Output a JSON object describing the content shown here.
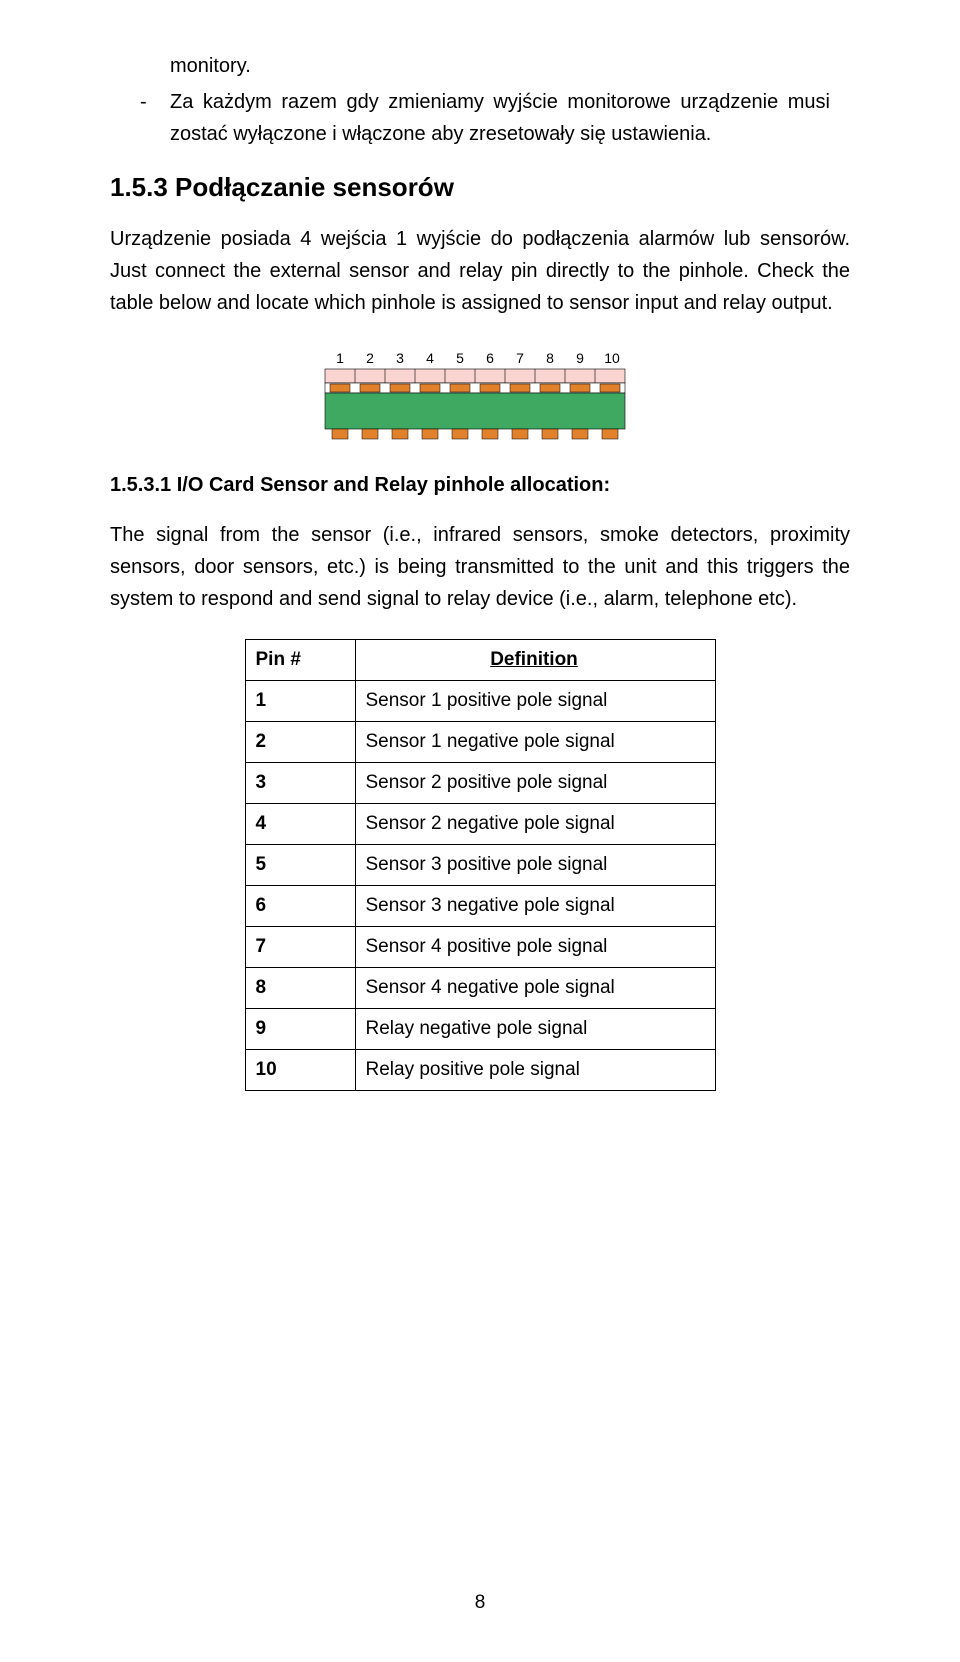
{
  "bullet1": "monitory.",
  "dash_text": "Za każdym razem gdy zmieniamy wyjście monitorowe urządzenie musi zostać wyłączone i włączone aby zresetowały się ustawienia.",
  "h2": "1.5.3  Podłączanie sensorów",
  "p1": "Urządzenie posiada 4 wejścia 1 wyjście do podłączenia alarmów lub sensorów. Just connect the external sensor and relay pin directly to the pinhole. Check the table below and locate which pinhole is assigned to sensor input and relay output.",
  "connector_labels": [
    "1",
    "2",
    "3",
    "4",
    "5",
    "6",
    "7",
    "8",
    "9",
    "10"
  ],
  "h3": "1.5.3.1 I/O Card Sensor and Relay pinhole allocation:",
  "p2": "The signal from the sensor (i.e., infrared sensors, smoke detectors, proximity sensors, door sensors, etc.) is being transmitted to the unit and this triggers the system to respond and send signal to relay device (i.e., alarm, telephone etc).",
  "table": {
    "head_pin": "Pin #",
    "head_def": "Definition",
    "rows": [
      {
        "pin": "1",
        "def": "Sensor 1 positive pole signal"
      },
      {
        "pin": "2",
        "def": "Sensor 1 negative pole signal"
      },
      {
        "pin": "3",
        "def": "Sensor 2 positive pole signal"
      },
      {
        "pin": "4",
        "def": "Sensor 2 negative pole signal"
      },
      {
        "pin": "5",
        "def": "Sensor 3 positive pole signal"
      },
      {
        "pin": "6",
        "def": "Sensor 3 negative pole signal"
      },
      {
        "pin": "7",
        "def": "Sensor 4 positive pole signal"
      },
      {
        "pin": "8",
        "def": "Sensor 4 negative pole signal"
      },
      {
        "pin": "9",
        "def": "Relay negative pole signal"
      },
      {
        "pin": "10",
        "def": "Relay positive pole signal"
      }
    ]
  },
  "page_num": "8"
}
